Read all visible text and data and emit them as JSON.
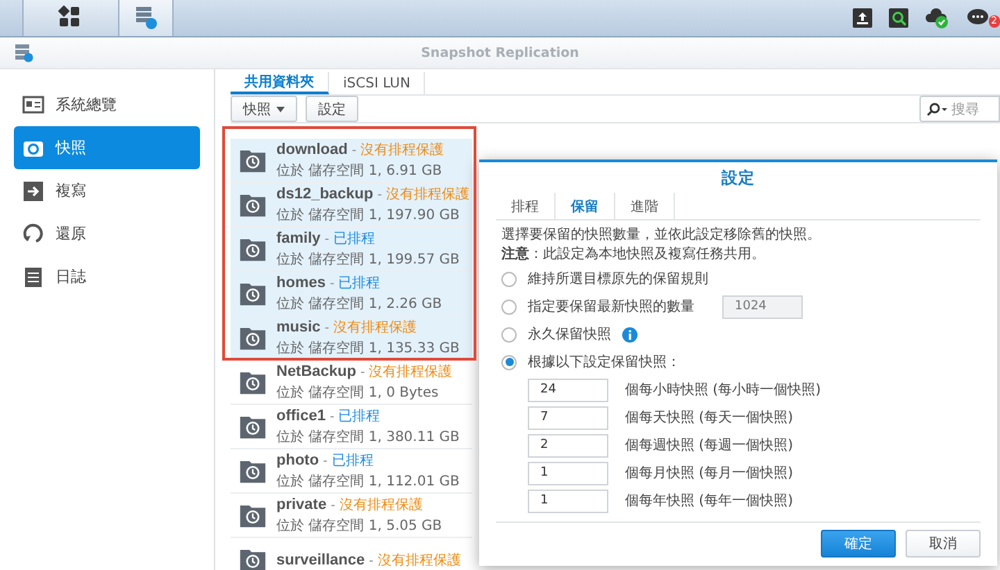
{
  "taskbar": {
    "apps": [
      {
        "kind": "menu",
        "selected": false
      },
      {
        "kind": "snapshot",
        "selected": true
      }
    ],
    "notification_count": "2"
  },
  "window": {
    "title": "Snapshot Replication"
  },
  "sidebar": {
    "items": [
      {
        "label": "系統總覽",
        "selected": false
      },
      {
        "label": "快照",
        "selected": true
      },
      {
        "label": "複寫",
        "selected": false
      },
      {
        "label": "還原",
        "selected": false
      },
      {
        "label": "日誌",
        "selected": false
      }
    ]
  },
  "tabs": [
    {
      "label": "共用資料夾",
      "selected": true
    },
    {
      "label": "iSCSI LUN",
      "selected": false
    }
  ],
  "toolbar": {
    "buttons": [
      {
        "label": "快照",
        "dropdown": true
      },
      {
        "label": "設定",
        "dropdown": false
      }
    ],
    "search": {
      "placeholder": "搜尋"
    }
  },
  "folders": [
    {
      "name": "download",
      "separator": "-",
      "status": "沒有排程保護",
      "scheduled": false,
      "location": "位於 儲存空間 1, 6.91 GB",
      "selected": true
    },
    {
      "name": "ds12_backup",
      "separator": "-",
      "status": "沒有排程保護",
      "scheduled": false,
      "location": "位於 儲存空間 1, 197.90 GB",
      "selected": true
    },
    {
      "name": "family",
      "separator": "-",
      "status": "已排程",
      "scheduled": true,
      "location": "位於 儲存空間 1, 199.57 GB",
      "selected": true
    },
    {
      "name": "homes",
      "separator": "-",
      "status": "已排程",
      "scheduled": true,
      "location": "位於 儲存空間 1, 2.26 GB",
      "selected": true
    },
    {
      "name": "music",
      "separator": "-",
      "status": "沒有排程保護",
      "scheduled": false,
      "location": "位於 儲存空間 1, 135.33 GB",
      "selected": true
    },
    {
      "name": "NetBackup",
      "separator": "-",
      "status": "沒有排程保護",
      "scheduled": false,
      "location": "位於 儲存空間 1, 0 Bytes",
      "selected": false
    },
    {
      "name": "office1",
      "separator": "-",
      "status": "已排程",
      "scheduled": true,
      "location": "位於 儲存空間 1, 380.11 GB",
      "selected": false
    },
    {
      "name": "photo",
      "separator": "-",
      "status": "已排程",
      "scheduled": true,
      "location": "位於 儲存空間 1, 112.01 GB",
      "selected": false
    },
    {
      "name": "private",
      "separator": "-",
      "status": "沒有排程保護",
      "scheduled": false,
      "location": "位於 儲存空間 1, 5.05 GB",
      "selected": false
    },
    {
      "name": "surveillance",
      "separator": "-",
      "status": "沒有排程保護",
      "scheduled": false,
      "selected": false
    }
  ],
  "dialog": {
    "title": "設定",
    "tabs": [
      {
        "label": "排程",
        "selected": false
      },
      {
        "label": "保留",
        "selected": true
      },
      {
        "label": "進階",
        "selected": false
      }
    ],
    "description": "選擇要保留的快照數量，並依此設定移除舊的快照。",
    "note": "**注意**：此設定為本地快照及複寫任務共用。",
    "options": [
      {
        "label": "維持所選目標原先的保留規則",
        "selected": false
      },
      {
        "label": "指定要保留最新快照的數量",
        "selected": false,
        "field": {
          "value": "1024",
          "disabled": true
        }
      },
      {
        "label": "永久保留快照",
        "selected": false,
        "info": true
      },
      {
        "label": "根據以下設定保留快照：",
        "selected": true
      }
    ],
    "retention": [
      {
        "value": "24",
        "label": "個每小時快照 (每小時一個快照)"
      },
      {
        "value": "7",
        "label": "個每天快照 (每天一個快照)"
      },
      {
        "value": "2",
        "label": "個每週快照 (每週一個快照)"
      },
      {
        "value": "1",
        "label": "個每月快照 (每月一個快照)"
      },
      {
        "value": "1",
        "label": "個每年快照 (每年一個快照)"
      }
    ],
    "buttons": [
      {
        "label": "確定",
        "primary": true
      },
      {
        "label": "取消",
        "primary": false
      }
    ]
  }
}
